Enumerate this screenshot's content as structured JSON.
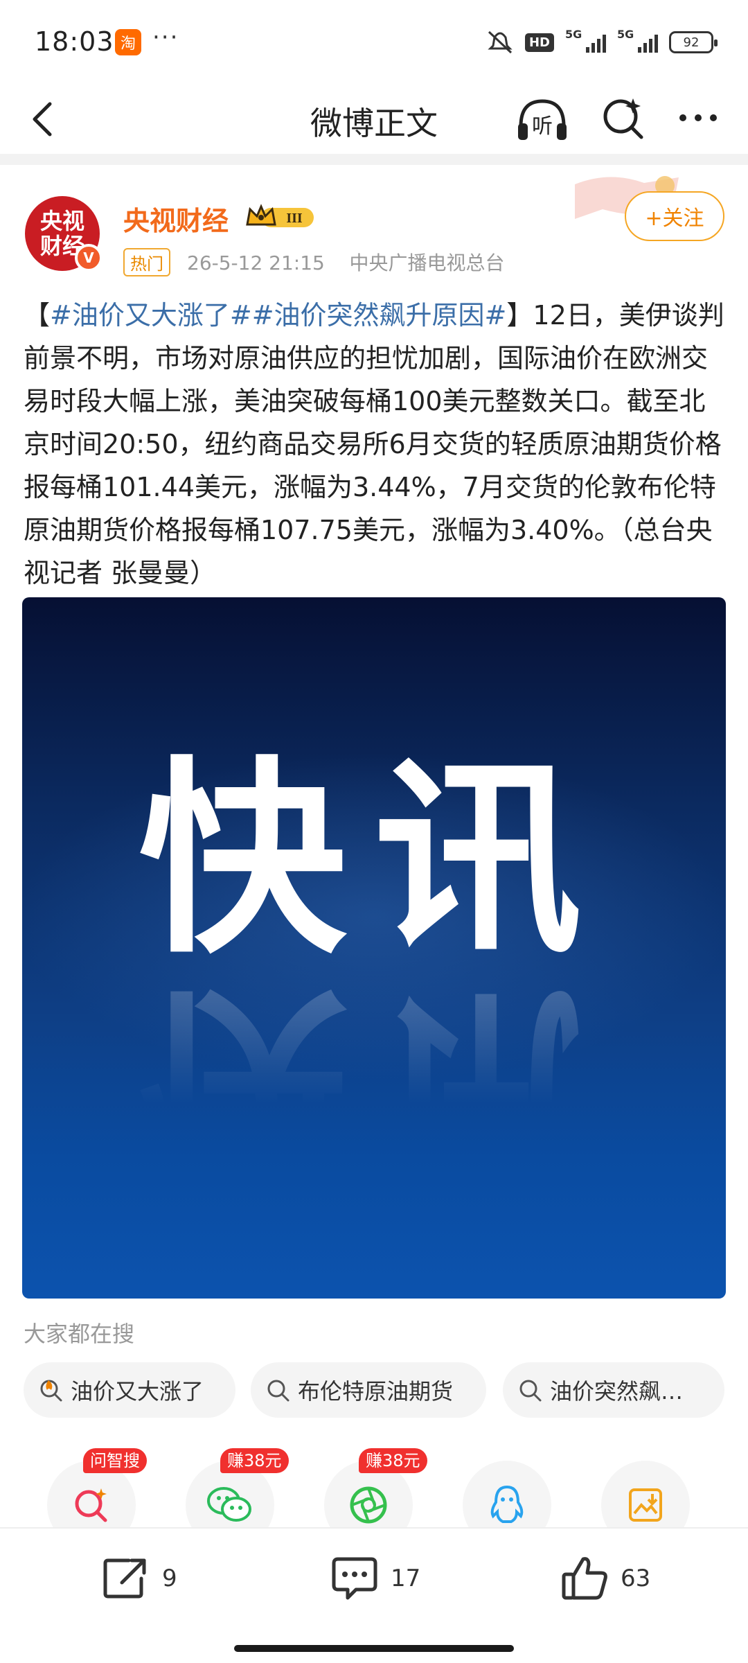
{
  "status_bar": {
    "time": "18:03",
    "app_icon": "淘",
    "more": "···",
    "hd": "HD",
    "network_1": "5G",
    "network_2": "5G",
    "battery": "92"
  },
  "header": {
    "title": "微博正文",
    "listen_label": "听"
  },
  "post": {
    "author": "央视财经",
    "avatar_text_line1": "央视",
    "avatar_text_line2": "财经",
    "vip_level": "III",
    "hot_tag": "热门",
    "date": "26-5-12 21:15",
    "source": "中央广播电视总台",
    "follow_label": "+关注",
    "body_open": "【",
    "topic_1": "#油价又大涨了#",
    "topic_2": "#油价突然飙升原因#",
    "body_close": "】",
    "body_text": "12日，美伊谈判前景不明，市场对原油供应的担忧加剧，国际油价在欧洲交易时段大幅上涨，美油突破每桶100美元整数关口。截至北京时间20:50，纽约商品交易所6月交货的轻质原油期货价格报每桶101.44美元，涨幅为3.44%，7月交货的伦敦布伦特原油期货价格报每桶107.75美元，涨幅为3.40%。（总台央视记者 张曼曼）",
    "image_text": "快讯"
  },
  "search": {
    "heading": "大家都在搜",
    "chips": [
      {
        "label": "油价又大涨了",
        "icon": "hot-search-icon"
      },
      {
        "label": "布伦特原油期货",
        "icon": "search-icon"
      },
      {
        "label": "油价突然飙…",
        "icon": "search-icon"
      }
    ]
  },
  "share": {
    "items": [
      {
        "badge": "问智搜",
        "icon": "ai-search-icon",
        "color": "#ee3a57"
      },
      {
        "badge": "赚38元",
        "icon": "wechat-icon",
        "color": "#2bbb5b"
      },
      {
        "badge": "赚38元",
        "icon": "moments-icon",
        "color": "#35c04d"
      },
      {
        "badge": "",
        "icon": "qq-icon",
        "color": "#29a3ee"
      },
      {
        "badge": "",
        "icon": "save-image-icon",
        "color": "#f2a51c"
      }
    ]
  },
  "actions": {
    "repost_count": "9",
    "comment_count": "17",
    "like_count": "63"
  },
  "colors": {
    "accent_orange": "#f26a1b",
    "topic_blue": "#3b6ea8",
    "badge_red": "#f0302e"
  }
}
